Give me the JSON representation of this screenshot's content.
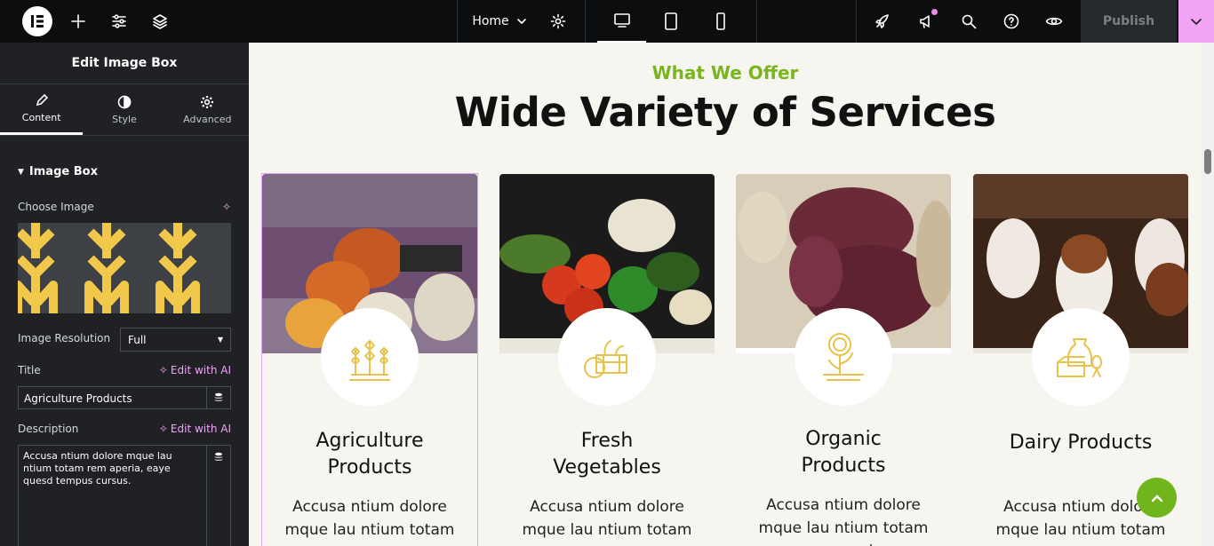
{
  "topbar": {
    "page_name": "Home",
    "publish_label": "Publish"
  },
  "panel": {
    "title": "Edit Image Box",
    "tabs": [
      {
        "label": "Content"
      },
      {
        "label": "Style"
      },
      {
        "label": "Advanced"
      }
    ],
    "section_title": "Image Box",
    "choose_image_label": "Choose Image",
    "image_resolution_label": "Image Resolution",
    "image_resolution_value": "Full",
    "title_label": "Title",
    "title_value": "Agriculture Products",
    "description_label": "Description",
    "description_value": "Accusa ntium dolore mque lau ntium totam rem aperia, eaye quesd tempus cursus.",
    "edit_ai_label": "Edit with AI"
  },
  "page": {
    "kicker": "What We Offer",
    "heading": "Wide Variety of Services",
    "cards": [
      {
        "title": "Agriculture Products",
        "desc": "Accusa ntium dolore mque lau ntium totam rem aperia,",
        "icon": "wheat-icon"
      },
      {
        "title": "Fresh Vegetables",
        "desc": "Accusa ntium dolore mque lau ntium totam rem aperia,",
        "icon": "vegetable-basket-icon"
      },
      {
        "title": "Organic Products",
        "desc": "Accusa ntium dolore mque lau ntium totam rem aperia,",
        "icon": "sunflower-icon"
      },
      {
        "title": "Dairy Products",
        "desc": "Accusa ntium dolore mque lau ntium totam rem aperia,",
        "icon": "dairy-icon"
      }
    ]
  },
  "colors": {
    "accent_green": "#7ab51d",
    "icon_gold": "#e8c24a",
    "panel_bg": "#1f2124",
    "ai_pink": "#f0a4f8"
  }
}
